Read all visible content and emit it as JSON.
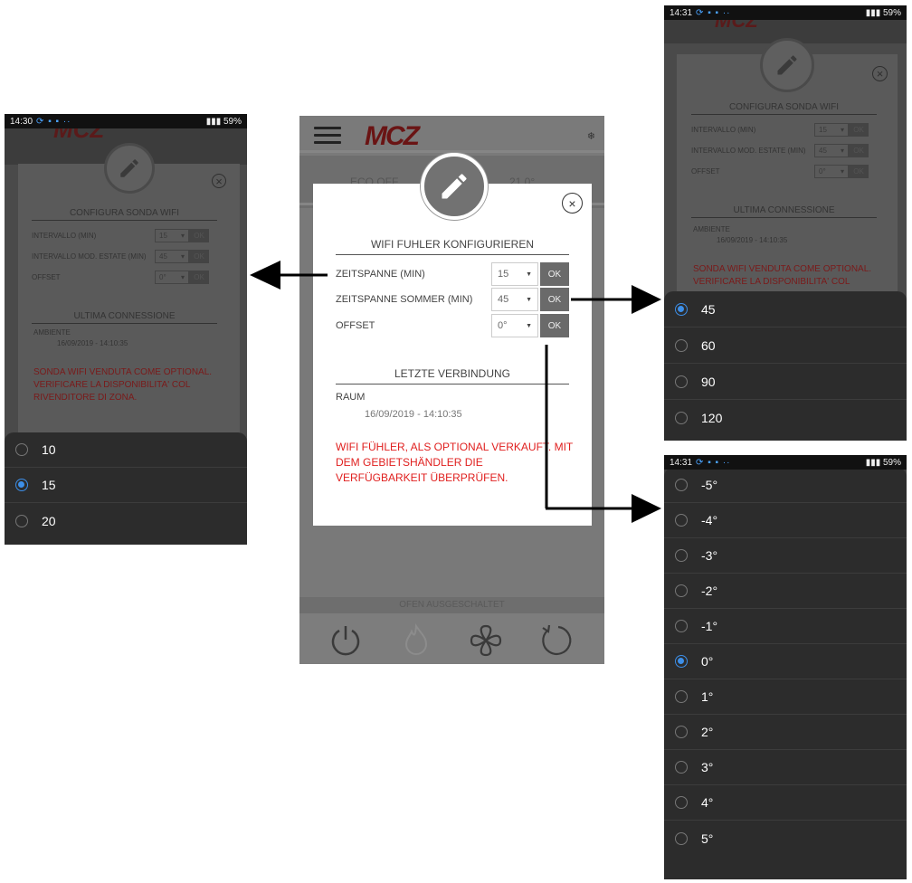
{
  "brand": {
    "logo": "MCZ"
  },
  "main": {
    "band_mode": "ECO OFF",
    "band_temp": "21,0°",
    "status_text": "OFEN AUSGESCHALTET",
    "dialog": {
      "title": "WIFI FUHLER KONFIGURIEREN",
      "rows": [
        {
          "label": "ZEITSPANNE (MIN)",
          "value": "15",
          "ok": "OK"
        },
        {
          "label": "ZEITSPANNE SOMMER (MIN)",
          "value": "45",
          "ok": "OK"
        },
        {
          "label": "OFFSET",
          "value": "0°",
          "ok": "OK"
        }
      ],
      "section_title": "LETZTE VERBINDUNG",
      "room_label": "RAUM",
      "timestamp": "16/09/2019 - 14:10:35",
      "warning": "WIFI FÜHLER, ALS OPTIONAL VERKAUFT. MIT DEM GEBIETSHÄNDLER DIE VERFÜGBARKEIT ÜBERPRÜFEN."
    }
  },
  "left_phone": {
    "status": {
      "time": "14:30",
      "battery": "59%"
    },
    "dialog": {
      "title": "CONFIGURA SONDA WIFI",
      "rows": [
        {
          "label": "INTERVALLO (MIN)",
          "value": "15",
          "ok": "OK"
        },
        {
          "label": "INTERVALLO MOD. ESTATE (MIN)",
          "value": "45",
          "ok": "OK"
        },
        {
          "label": "OFFSET",
          "value": "0°",
          "ok": "OK"
        }
      ],
      "section_title": "ULTIMA CONNESSIONE",
      "room_label": "AMBIENTE",
      "timestamp": "16/09/2019 - 14:10:35",
      "warning": "SONDA WIFI VENDUTA COME OPTIONAL. VERIFICARE LA DISPONIBILITA' COL RIVENDITORE DI ZONA."
    },
    "options": [
      {
        "label": "10",
        "selected": false
      },
      {
        "label": "15",
        "selected": true
      },
      {
        "label": "20",
        "selected": false
      }
    ]
  },
  "right_top_phone": {
    "status": {
      "time": "14:31",
      "battery": "59%"
    },
    "options": [
      {
        "label": "45",
        "selected": true
      },
      {
        "label": "60",
        "selected": false
      },
      {
        "label": "90",
        "selected": false
      },
      {
        "label": "120",
        "selected": false
      }
    ]
  },
  "right_bottom_phone": {
    "status": {
      "time": "14:31",
      "battery": "59%"
    },
    "options": [
      {
        "label": "-5°",
        "selected": false
      },
      {
        "label": "-4°",
        "selected": false
      },
      {
        "label": "-3°",
        "selected": false
      },
      {
        "label": "-2°",
        "selected": false
      },
      {
        "label": "-1°",
        "selected": false
      },
      {
        "label": "0°",
        "selected": true
      },
      {
        "label": "1°",
        "selected": false
      },
      {
        "label": "2°",
        "selected": false
      },
      {
        "label": "3°",
        "selected": false
      },
      {
        "label": "4°",
        "selected": false
      },
      {
        "label": "5°",
        "selected": false
      }
    ]
  },
  "colors": {
    "warning_red": "#e0201f",
    "radio_selected": "#3d8fe8",
    "sheet_bg": "#2c2c2c",
    "ok_button": "#6a6a6a"
  }
}
